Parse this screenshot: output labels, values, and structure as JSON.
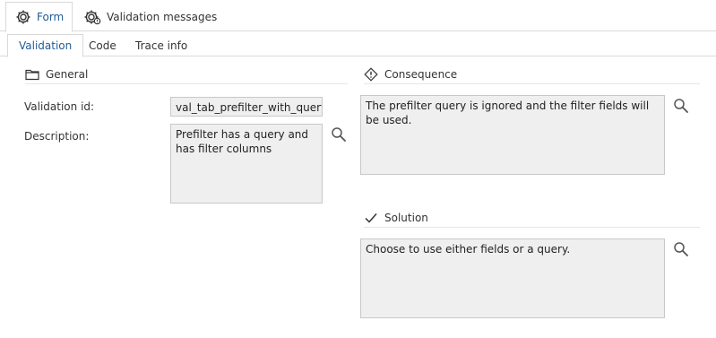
{
  "top_tabs": [
    {
      "label": "Form",
      "icon": "form-gear-icon",
      "active": true
    },
    {
      "label": "Validation messages",
      "icon": "validation-gear-icon",
      "active": false
    }
  ],
  "sub_tabs": [
    {
      "label": "Validation",
      "active": true
    },
    {
      "label": "Code",
      "active": false
    },
    {
      "label": "Trace info",
      "active": false
    }
  ],
  "general": {
    "title": "General",
    "icon": "folder-icon",
    "validation_id_label": "Validation id:",
    "validation_id_value": "val_tab_prefilter_with_query_and_filter_columns",
    "description_label": "Description:",
    "description_value": "Prefilter has a query and has filter columns"
  },
  "consequence": {
    "title": "Consequence",
    "icon": "diamond-warning-icon",
    "value": "The prefilter query is ignored and the filter fields will be used."
  },
  "solution": {
    "title": "Solution",
    "icon": "checkmark-icon",
    "value": "Choose to use either fields or a query."
  },
  "colors": {
    "accent": "#1f5a96",
    "field_bg": "#efefef",
    "border": "#c8c8c8"
  }
}
